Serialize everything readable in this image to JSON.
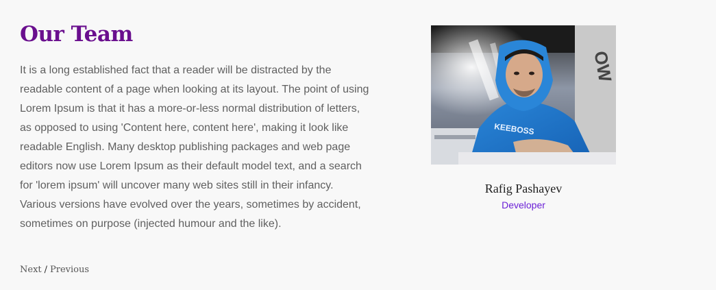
{
  "section": {
    "title": "Our Team",
    "description": "It is a long established fact that a reader will be distracted by the readable content of a page when looking at its layout. The point of using Lorem Ipsum is that it has a more-or-less normal distribution of letters, as opposed to using 'Content here, content here', making it look like readable English. Many desktop publishing packages and web page editors now use Lorem Ipsum as their default model text, and a search for 'lorem ipsum' will uncover many web sites still in their infancy. Various versions have evolved over the years, sometimes by accident, sometimes on purpose (injected humour and the like)."
  },
  "member": {
    "name": "Rafig Pashayev",
    "role": "Developer",
    "photo_icon": "person-photo"
  },
  "pager": {
    "next_label": "Next",
    "separator": "/",
    "previous_label": "Previous"
  },
  "colors": {
    "title": "#6a0f8e",
    "role": "#6a1fd6",
    "background": "#f8f8f8",
    "body_text": "#5f5f5f"
  }
}
